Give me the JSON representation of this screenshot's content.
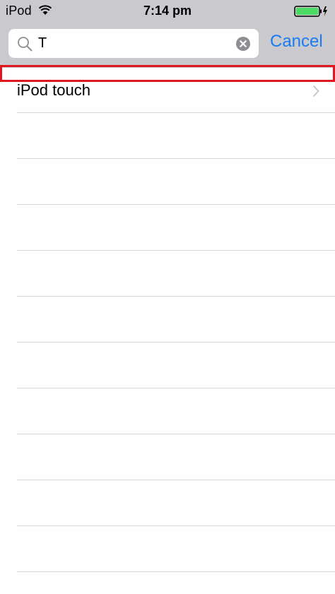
{
  "status_bar": {
    "carrier": "iPod",
    "time": "7:14 pm",
    "wifi_icon": "wifi-icon",
    "battery_icon": "battery-charging-icon",
    "battery_color": "#4cd964"
  },
  "search": {
    "value": "T",
    "search_icon": "search-icon",
    "clear_icon": "clear-icon",
    "cancel_label": "Cancel"
  },
  "results": [
    {
      "label": "iPod touch",
      "icon": "chevron-right-icon"
    }
  ],
  "colors": {
    "accent": "#1a7cf2",
    "highlight": "#e0171f",
    "header_bg": "#c9c9ce"
  }
}
